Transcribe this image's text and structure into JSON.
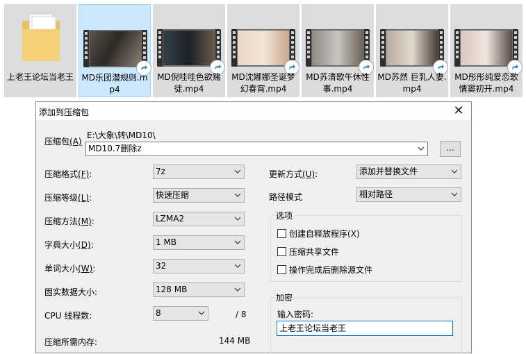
{
  "explorer": {
    "items": [
      {
        "type": "folder",
        "label": "上老王论坛当老王"
      },
      {
        "type": "video",
        "label": "MD乐团潜规则.mp4",
        "selected": true
      },
      {
        "type": "video",
        "label": "MD倪哇哇色欲赌徒.mp4"
      },
      {
        "type": "video",
        "label": "MD沈娜娜圣诞梦幻春宵.mp4"
      },
      {
        "type": "video",
        "label": "MD苏清歌午休性事.mp4"
      },
      {
        "type": "video",
        "label": "MD苏然 巨乳人妻.mp4"
      },
      {
        "type": "video",
        "label": "MD彤彤纯爱恋歌 情窦初开.mp4"
      }
    ]
  },
  "dialog": {
    "title": "添加到压缩包",
    "archive": {
      "label": "压缩包",
      "hotkey": "(A)",
      "path": "E:\\大象\\转\\MD10\\",
      "name": "MD10.7删除z",
      "browse_label": "..."
    },
    "left": [
      {
        "label": "压缩格式",
        "hotkey": "(F)",
        "suffix": ":",
        "value": "7z"
      },
      {
        "label": "压缩等级",
        "hotkey": "(L)",
        "suffix": ":",
        "value": "快速压缩"
      },
      {
        "label": "压缩方法",
        "hotkey": "(M)",
        "suffix": ":",
        "value": "LZMA2"
      },
      {
        "label": "字典大小",
        "hotkey": "(D)",
        "suffix": ":",
        "value": "1 MB"
      },
      {
        "label": "单词大小",
        "hotkey": "(W)",
        "suffix": ":",
        "value": "32"
      },
      {
        "label": "固实数据大小:",
        "hotkey": "",
        "suffix": "",
        "value": "128 MB"
      }
    ],
    "threads": {
      "label": "CPU 线程数:",
      "value": "8",
      "max": "/ 8"
    },
    "memory": {
      "label": "压缩所需内存:",
      "value": "144 MB"
    },
    "update_mode": {
      "label": "更新方式",
      "hotkey": "(U)",
      "suffix": ":",
      "value": "添加并替换文件"
    },
    "path_mode": {
      "label": "路径模式",
      "value": "相对路径"
    },
    "options": {
      "title": "选项",
      "items": [
        {
          "label": "创建自释放程序",
          "hotkey": "(X)",
          "checked": false
        },
        {
          "label": "压缩共享文件",
          "hotkey": "",
          "checked": false
        },
        {
          "label": "操作完成后删除源文件",
          "hotkey": "",
          "checked": false
        }
      ]
    },
    "encryption": {
      "title": "加密",
      "password_label": "输入密码:",
      "password_value": "上老王论坛当老王"
    }
  },
  "colors": {
    "selected_bg": "#cce8ff",
    "tile_bg": "#dcdcdc",
    "dialog_bg": "#f0f0f0",
    "focus_border": "#0078d7"
  }
}
